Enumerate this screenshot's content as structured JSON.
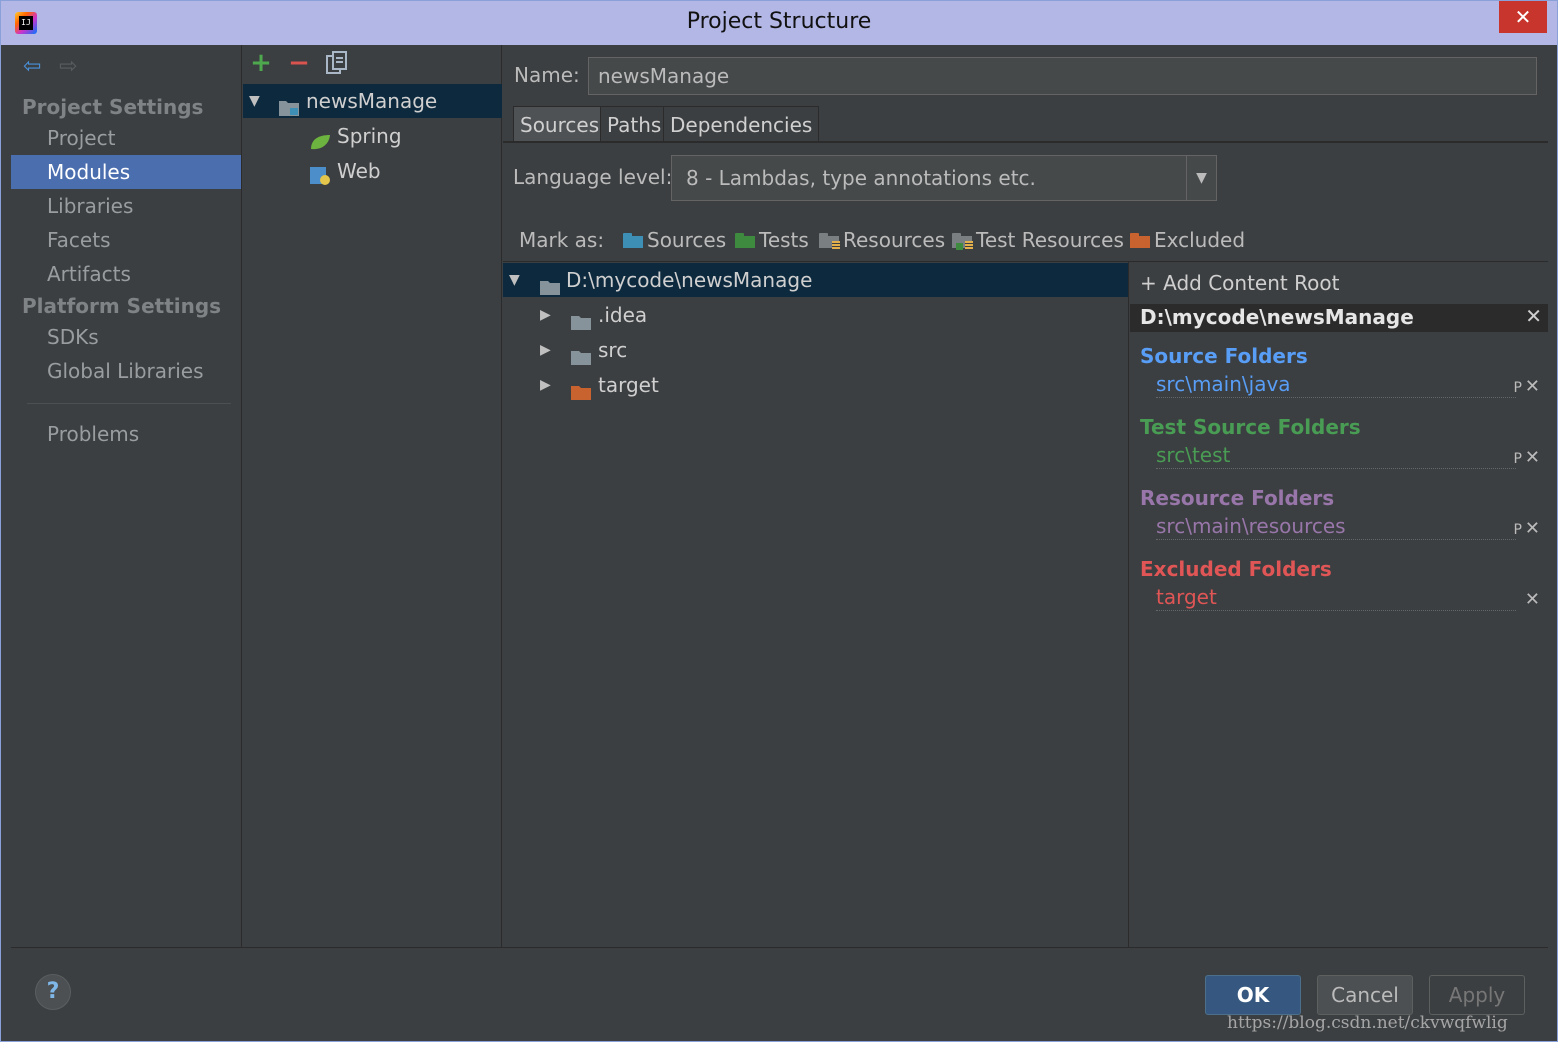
{
  "window": {
    "title": "Project Structure",
    "close_glyph": "✕"
  },
  "nav": {
    "back_glyph": "⇦",
    "forward_glyph": "⇨",
    "project_settings_title": "Project Settings",
    "project_settings_items": [
      "Project",
      "Modules",
      "Libraries",
      "Facets",
      "Artifacts"
    ],
    "platform_settings_title": "Platform Settings",
    "platform_settings_items": [
      "SDKs",
      "Global Libraries"
    ],
    "problems": "Problems",
    "selected": "Modules"
  },
  "modules": {
    "add_glyph": "+",
    "remove_glyph": "−",
    "root": "newsManage",
    "children": [
      "Spring",
      "Web"
    ]
  },
  "content": {
    "name_label": "Name:",
    "name_value": "newsManage",
    "tabs": [
      "Sources",
      "Paths",
      "Dependencies"
    ],
    "active_tab": "Sources",
    "language_label": "Language level:",
    "language_value": "8 - Lambdas, type annotations etc.",
    "language_arrow": "▼",
    "mark_as_label": "Mark as:",
    "mark_items": [
      {
        "label": "Sources",
        "color": "#3d8fb5"
      },
      {
        "label": "Tests",
        "color": "#3e8a3e"
      },
      {
        "label": "Resources",
        "color": "#7a7f82"
      },
      {
        "label": "Test Resources",
        "color": "#7a7f82"
      },
      {
        "label": "Excluded",
        "color": "#c8632f"
      }
    ]
  },
  "filetree": {
    "root": "D:\\mycode\\newsManage",
    "expanded_glyph": "▼",
    "collapsed_glyph": "▶",
    "children": [
      {
        "label": ".idea",
        "color": "#87939a"
      },
      {
        "label": "src",
        "color": "#87939a"
      },
      {
        "label": "target",
        "color": "#c8632f"
      }
    ]
  },
  "roots": {
    "add_content_root": "+ Add Content Root",
    "root_path": "D:\\mycode\\newsManage",
    "remove_glyph": "✕",
    "edit_glyph": "P",
    "groups": [
      {
        "title": "Source Folders",
        "color": "#589df6",
        "item": "src\\main\\java",
        "item_color": "#589df6",
        "editable": true
      },
      {
        "title": "Test Source Folders",
        "color": "#499c54",
        "item": "src\\test",
        "item_color": "#499c54",
        "editable": true
      },
      {
        "title": "Resource Folders",
        "color": "#9876aa",
        "item": "src\\main\\resources",
        "item_color": "#9876aa",
        "editable": true
      },
      {
        "title": "Excluded Folders",
        "color": "#e05555",
        "item": "target",
        "item_color": "#e05555",
        "editable": false
      }
    ]
  },
  "buttons": {
    "help": "?",
    "ok": "OK",
    "cancel": "Cancel",
    "apply": "Apply"
  },
  "watermark": "https://blog.csdn.net/ckvwqfwlig"
}
